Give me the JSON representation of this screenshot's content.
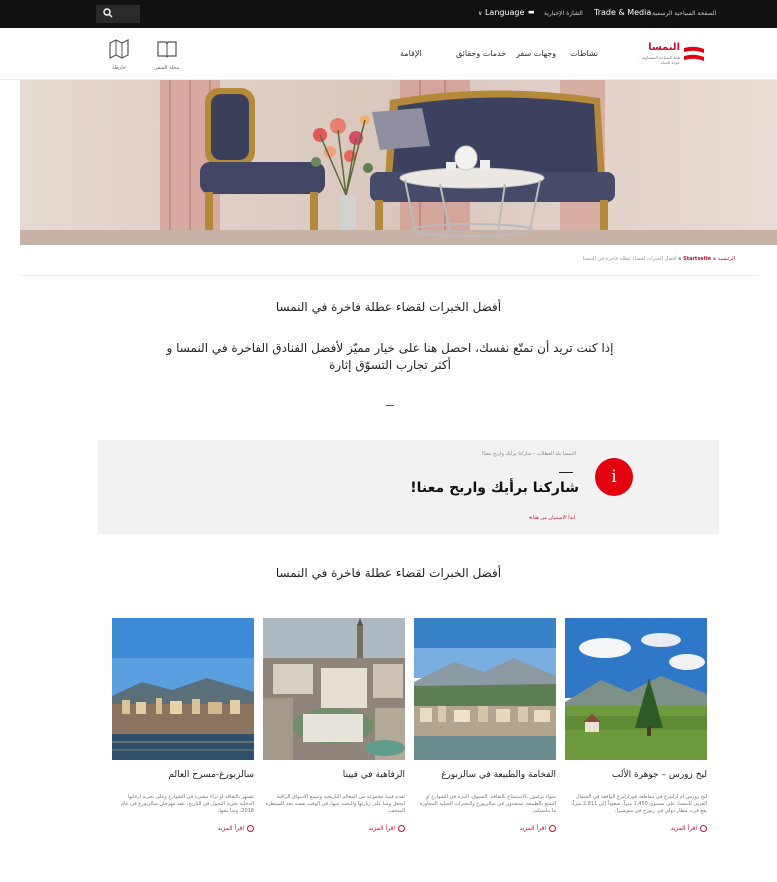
{
  "topbar": {
    "language_label": "Language",
    "items": [
      "الصفحة السياحية الرسمية",
      "Trade & Media",
      "الشارة الإخبارية"
    ]
  },
  "header": {
    "logo_text": "النمسا",
    "logo_sub": "هيئة السياحة النمساوية - جودة الحياة",
    "icons": [
      {
        "name": "travel-map",
        "label": "خارطة"
      },
      {
        "name": "travel-book",
        "label": "مجلة السفر"
      }
    ],
    "nav": [
      "نشاطات",
      "وجهات سفر",
      "خدمات وحقائق",
      "الإقامة"
    ]
  },
  "breadcrumb": {
    "home": "الرئيسية",
    "middle": "Startseite",
    "current": "أفضل الخبرات لقضاء عطلة فاخرة في النمسا"
  },
  "page": {
    "title": "أفضل الخبرات لقضاء عطلة فاخرة في النمسا",
    "intro": "إذا كنت تريد أن تمتّع نفسك، احصل هنا على خيار مميّز لأفضل الفنادق الفاخرة في النمسا و أكثر تجارب التسوّق إثارة"
  },
  "info": {
    "small": "النمسا بلد العطلات - شاركنا برأيك واربح معنا!",
    "headline": "شاركنا برأيك واربح معنا!",
    "link": "ابدأ الاستبيان من هنا"
  },
  "section": {
    "title": "أفضل الخبرات لقضاء عطلة فاخرة في النمسا"
  },
  "cards": [
    {
      "title": "سالزبورغ-مسرح العالم",
      "desc": "تشتهر بالثقافة أو تزاء مشيء في الشوارع وعلى تجربة أرقاتها الدخلية تجربة التجول في التاريخ، عقد مهرجان سالزبورغ في عام 2018، ومنا معها،",
      "more": "اقرأ المزيد"
    },
    {
      "title": "الرفاهية في فيينا",
      "desc": "تقدم فيينا مجموعة من المعالم التاريخية وتتمتع الأسواق الراقية لتجعل ومنا على زيارتها والبحث عنها، في الوقت نفسه نجد للسيطرة المتحف،",
      "more": "اقرأ المزيد"
    },
    {
      "title": "الفخامة والطبيعة في سالزبورغ",
      "desc": "سواء ترغبون بالاستمتاع بالثقافة، التسوق، التنزه في الشوارع أو التمتع بالطبيعة، ستجدون في سالزبورغ والبحيرات الجبلية المجاورة ما يناسبكم،",
      "more": "اقرأ المزيد"
    },
    {
      "title": "ليخ زورس – جوهرة الألب",
      "desc": "ليخ زورس أم أرلبيرغ في مقاطعة فورارلبرغ الواقعة في الشمال الغربي للنمسا، على مستوى 1.450 متراً، صعوداً إلى 2.811 متراً، يقع قرب مطار دولي في زيورخ في سويسرا،",
      "more": "اقرأ المزيد"
    }
  ],
  "colors": {
    "accent": "#c8102e",
    "topbar": "#111111",
    "panel": "#f2f2f2"
  }
}
